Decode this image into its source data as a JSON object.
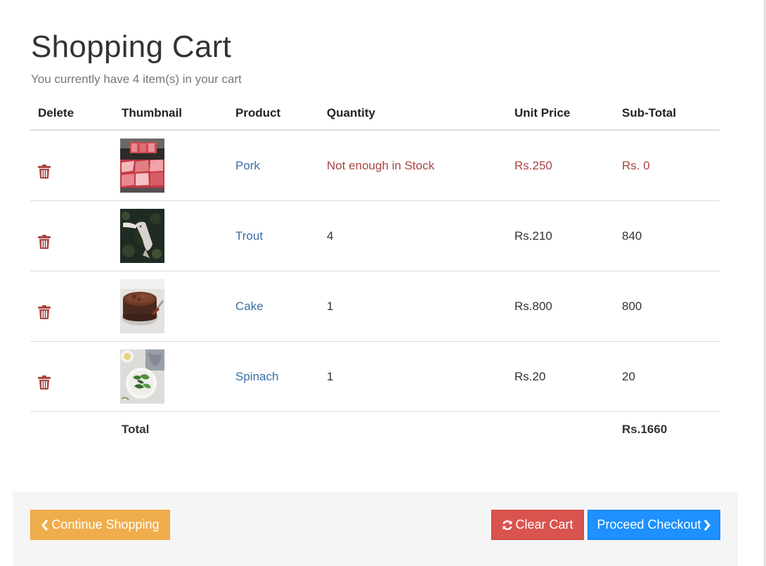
{
  "page": {
    "title": "Shopping Cart",
    "subtitle": "You currently have 4 item(s) in your cart"
  },
  "table": {
    "headers": {
      "delete": "Delete",
      "thumbnail": "Thumbnail",
      "product": "Product",
      "quantity": "Quantity",
      "unit_price": "Unit Price",
      "subtotal": "Sub-Total"
    },
    "rows": [
      {
        "product": "Pork",
        "quantity": "Not enough in Stock",
        "unit_price": "Rs.250",
        "subtotal": "Rs. 0",
        "out_of_stock": true,
        "thumbnail_icon": "pork-meat-tray-image"
      },
      {
        "product": "Trout",
        "quantity": "4",
        "unit_price": "Rs.210",
        "subtotal": "840",
        "out_of_stock": false,
        "thumbnail_icon": "trout-fish-image"
      },
      {
        "product": "Cake",
        "quantity": "1",
        "unit_price": "Rs.800",
        "subtotal": "800",
        "out_of_stock": false,
        "thumbnail_icon": "chocolate-cake-image"
      },
      {
        "product": "Spinach",
        "quantity": "1",
        "unit_price": "Rs.20",
        "subtotal": "20",
        "out_of_stock": false,
        "thumbnail_icon": "spinach-bowl-image"
      }
    ],
    "total_label": "Total",
    "total_value": "Rs.1660"
  },
  "actions": {
    "continue_label": "Continue Shopping",
    "clear_label": "Clear Cart",
    "checkout_label": "Proceed Checkout"
  },
  "colors": {
    "link": "#3a6ea5",
    "warning": "#a94442",
    "continue_button": "#f0ad4e",
    "clear_button": "#d9534f",
    "checkout_button": "#1e90ff"
  }
}
